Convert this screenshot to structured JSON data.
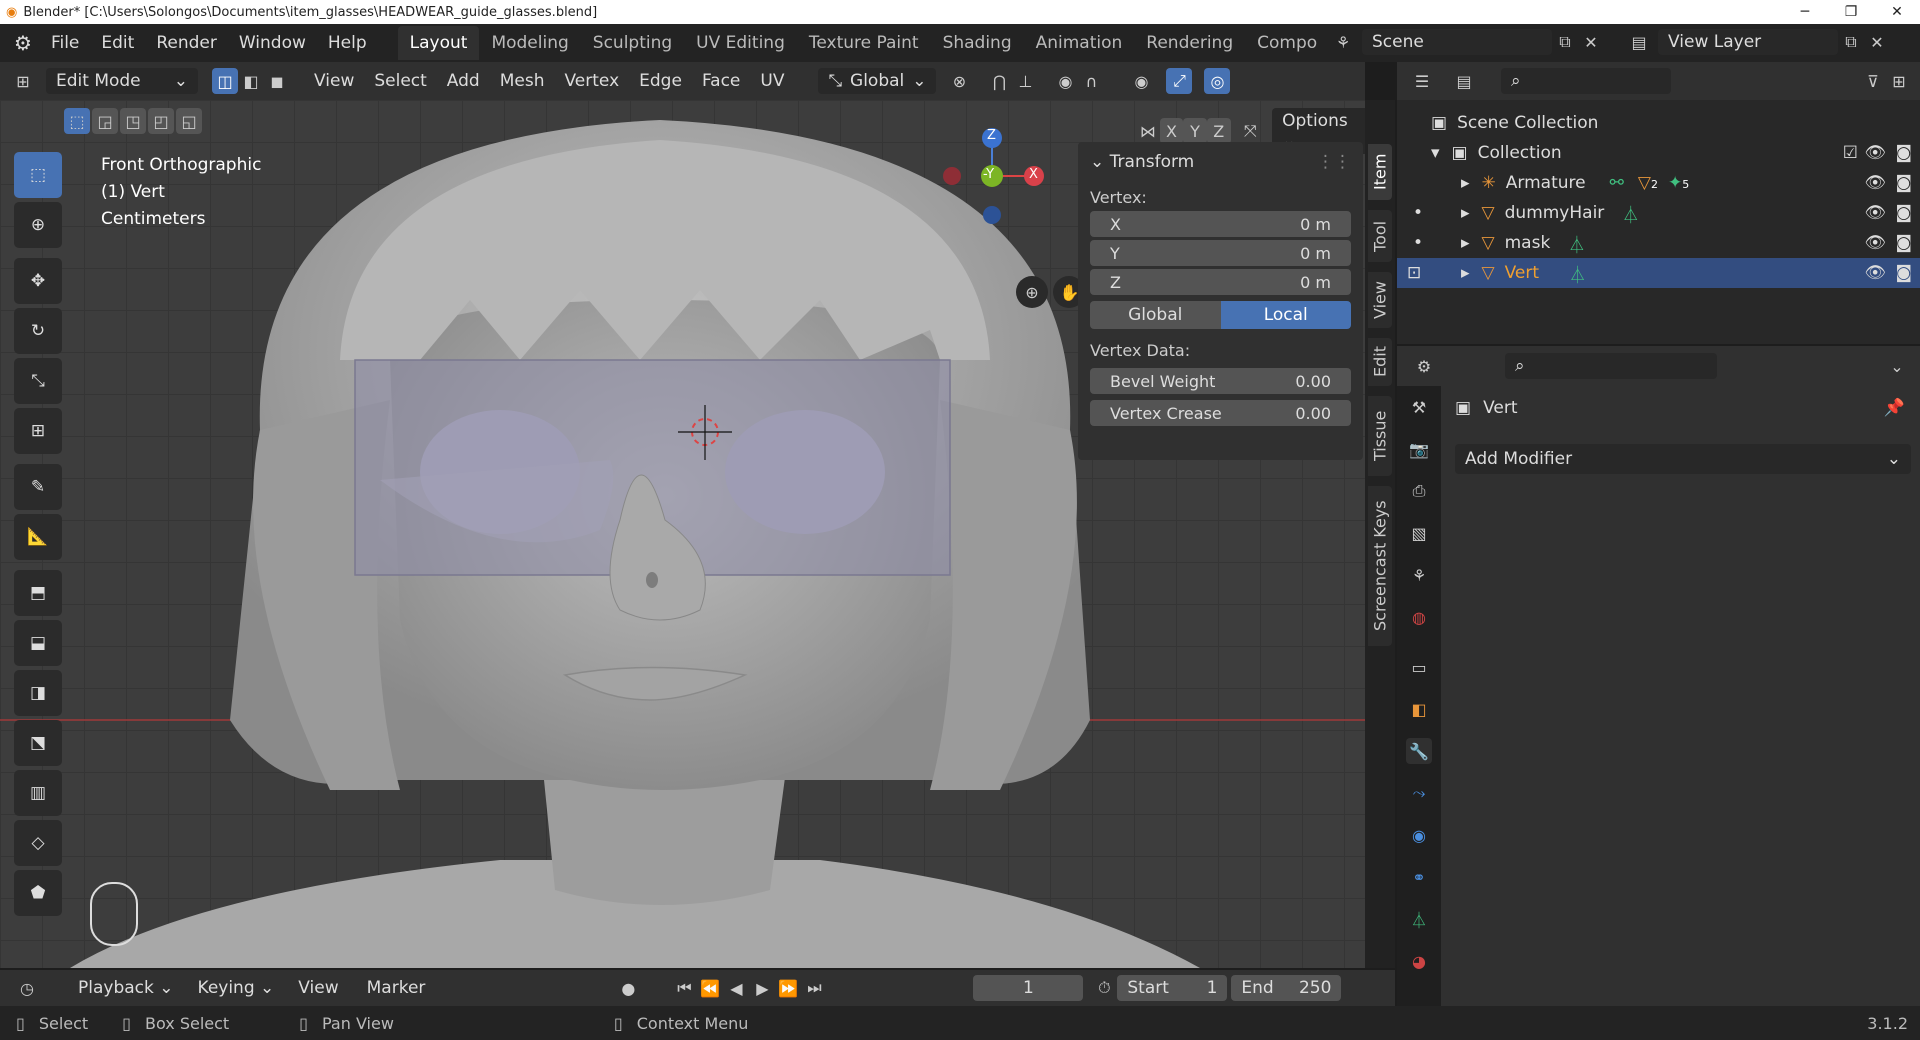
{
  "titlebar": {
    "title": "Blender* [C:\\Users\\Solongos\\Documents\\item_glasses\\HEADWEAR_guide_glasses.blend]"
  },
  "menu": [
    "File",
    "Edit",
    "Render",
    "Window",
    "Help"
  ],
  "workspaces": [
    "Layout",
    "Modeling",
    "Sculpting",
    "UV Editing",
    "Texture Paint",
    "Shading",
    "Animation",
    "Rendering",
    "Compo"
  ],
  "scene": {
    "name": "Scene",
    "view_layer": "View Layer"
  },
  "header": {
    "mode": "Edit Mode",
    "menus": [
      "View",
      "Select",
      "Add",
      "Mesh",
      "Vertex",
      "Edge",
      "Face",
      "UV"
    ],
    "orientation": "Global",
    "axes": [
      "X",
      "Y",
      "Z"
    ],
    "options": "Options"
  },
  "viewport": {
    "view_name": "Front Orthographic",
    "object_line": "(1) Vert",
    "units": "Centimeters",
    "gizmo": {
      "z": "Z",
      "y": "-Y",
      "x": "X"
    }
  },
  "npanel": {
    "title": "Transform",
    "vertex_label": "Vertex:",
    "fields": [
      {
        "label": "X",
        "value": "0 m"
      },
      {
        "label": "Y",
        "value": "0 m"
      },
      {
        "label": "Z",
        "value": "0 m"
      }
    ],
    "toggle": {
      "global": "Global",
      "local": "Local"
    },
    "vertex_data_label": "Vertex Data:",
    "data_fields": [
      {
        "label": "Bevel Weight",
        "value": "0.00"
      },
      {
        "label": "Vertex Crease",
        "value": "0.00"
      }
    ]
  },
  "side_tabs": [
    "Item",
    "Tool",
    "View",
    "Edit",
    "Tissue",
    "Screencast Keys"
  ],
  "outliner": {
    "scene_collection": "Scene Collection",
    "collection": "Collection",
    "items": [
      {
        "name": "Armature",
        "badge1": "2",
        "badge2": "5"
      },
      {
        "name": "dummyHair"
      },
      {
        "name": "mask"
      },
      {
        "name": "Vert"
      }
    ]
  },
  "properties": {
    "object_name": "Vert",
    "add_modifier": "Add Modifier"
  },
  "timeline": {
    "menus": [
      "Playback",
      "Keying",
      "View",
      "Marker"
    ],
    "current_frame": "1",
    "start_label": "Start",
    "start": "1",
    "end_label": "End",
    "end": "250"
  },
  "statusbar": {
    "select": "Select",
    "box_select": "Box Select",
    "pan_view": "Pan View",
    "context_menu": "Context Menu",
    "version": "3.1.2"
  },
  "colors": {
    "accent": "#4772b3",
    "selected_row": "#334d80",
    "orange": "#e8963a",
    "green": "#40c080"
  }
}
